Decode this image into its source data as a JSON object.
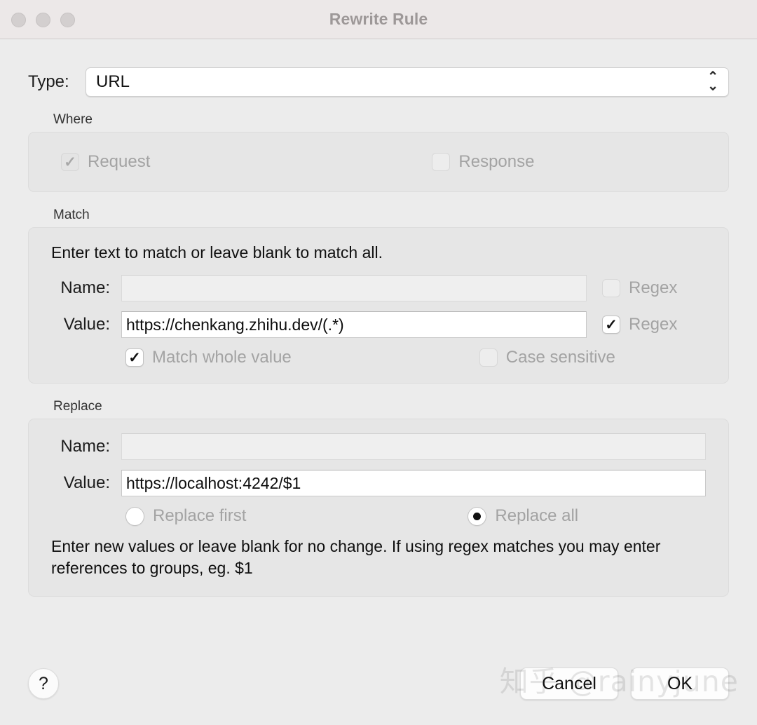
{
  "window": {
    "title": "Rewrite Rule",
    "traffic_lights": [
      "close",
      "minimize",
      "zoom"
    ]
  },
  "type_row": {
    "label": "Type:",
    "value": "URL",
    "options": [
      "URL"
    ],
    "stepper_up": "⌃",
    "stepper_down": "⌄"
  },
  "where": {
    "title": "Where",
    "request": {
      "label": "Request",
      "checked": true,
      "enabled": false,
      "mark": "✓"
    },
    "response": {
      "label": "Response",
      "checked": false,
      "enabled": false,
      "mark": ""
    }
  },
  "match": {
    "title": "Match",
    "hint": "Enter text to match or leave blank to match all.",
    "name": {
      "label": "Name:",
      "value": "",
      "placeholder": "",
      "enabled": false,
      "regex": {
        "label": "Regex",
        "checked": false,
        "mark": ""
      }
    },
    "value": {
      "label": "Value:",
      "value": "https://chenkang.zhihu.dev/(.*)",
      "placeholder": "",
      "enabled": true,
      "regex": {
        "label": "Regex",
        "checked": true,
        "mark": "✓"
      }
    },
    "match_whole_value": {
      "label": "Match whole value",
      "checked": true,
      "mark": "✓"
    },
    "case_sensitive": {
      "label": "Case sensitive",
      "checked": false,
      "mark": ""
    }
  },
  "replace": {
    "title": "Replace",
    "name": {
      "label": "Name:",
      "value": "",
      "placeholder": "",
      "enabled": false
    },
    "value": {
      "label": "Value:",
      "value": "https://localhost:4242/$1",
      "placeholder": "",
      "enabled": true
    },
    "replace_first": {
      "label": "Replace first",
      "selected": false
    },
    "replace_all": {
      "label": "Replace all",
      "selected": true
    },
    "hint": "Enter new values or leave blank for no change. If using regex matches you may enter references to groups, eg. $1"
  },
  "footer": {
    "help_label": "?",
    "cancel_label": "Cancel",
    "ok_label": "OK"
  },
  "watermark": {
    "text": "知乎 @rainyjune"
  },
  "colors": {
    "window_bg": "#ececec",
    "titlebar_bg": "#ece8e8",
    "group_bg": "#e6e6e6",
    "title_text": "#9d9898",
    "disabled_label": "#a3a3a3",
    "text": "#101010"
  }
}
